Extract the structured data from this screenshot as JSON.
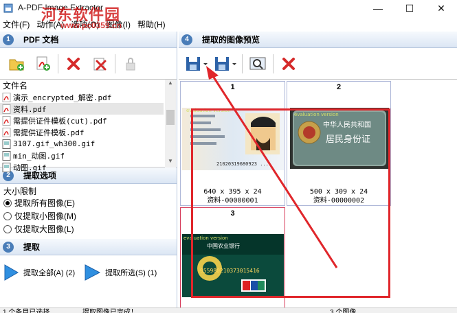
{
  "window": {
    "title": "A-PDF Image Extractor",
    "min": "—",
    "max": "☐",
    "close": "✕"
  },
  "watermark": {
    "main": "河东软件园",
    "url": "www.pc0359.cn"
  },
  "menu": [
    "文件(F)",
    "动作(A)",
    "选项(O)",
    "图像(I)",
    "帮助(H)"
  ],
  "left": {
    "pdf_panel": {
      "num": "1",
      "title": "PDF 文档"
    },
    "file_header": "文件名",
    "files": [
      {
        "name": "演示_encrypted_解密.pdf",
        "type": "pdf"
      },
      {
        "name": "资料.pdf",
        "type": "pdf"
      },
      {
        "name": "需提供证件模板(cut).pdf",
        "type": "pdf"
      },
      {
        "name": "需提供证件模板.pdf",
        "type": "pdf"
      },
      {
        "name": "3107.gif_wh300.gif",
        "type": "img"
      },
      {
        "name": "min_动图.gif",
        "type": "img"
      },
      {
        "name": "动图.gif",
        "type": "img"
      }
    ],
    "options_panel": {
      "num": "2",
      "title": "提取选项"
    },
    "size_limit": "大小限制",
    "radios": [
      {
        "label": "提取所有图像(E)",
        "checked": true
      },
      {
        "label": "仅提取小图像(M)",
        "checked": false
      },
      {
        "label": "仅提取大图像(L)",
        "checked": false
      }
    ],
    "extract_panel": {
      "num": "3",
      "title": "提取"
    },
    "extract_all": "提取全部(A) (2)",
    "extract_selected": "提取所选(S) (1)"
  },
  "right": {
    "panel": {
      "num": "4",
      "title": "提取的图像预览"
    },
    "images": [
      {
        "num": "1",
        "dims": "640 x 395 x 24",
        "name": "资料-00000001"
      },
      {
        "num": "2",
        "dims": "500 x 309 x 24",
        "name": "资料-00000002"
      },
      {
        "num": "3"
      }
    ],
    "card_texts": {
      "eval1": "evaluation version",
      "idnum": "21020319680923 ...",
      "eval2": "evaluation version",
      "cn_title": "中华人民共和国",
      "cn_sub": "居民身份证",
      "eval3": "evaluation version",
      "bank": "中国农业银行",
      "cardnum": "955980210373015416"
    }
  },
  "status": {
    "s1": "1 个条目已选择",
    "s2": "提取图像已完成！",
    "s3": "3 个图像"
  },
  "colors": {
    "annotation_red": "#e0262b",
    "header_blue": "#4a7db8"
  }
}
